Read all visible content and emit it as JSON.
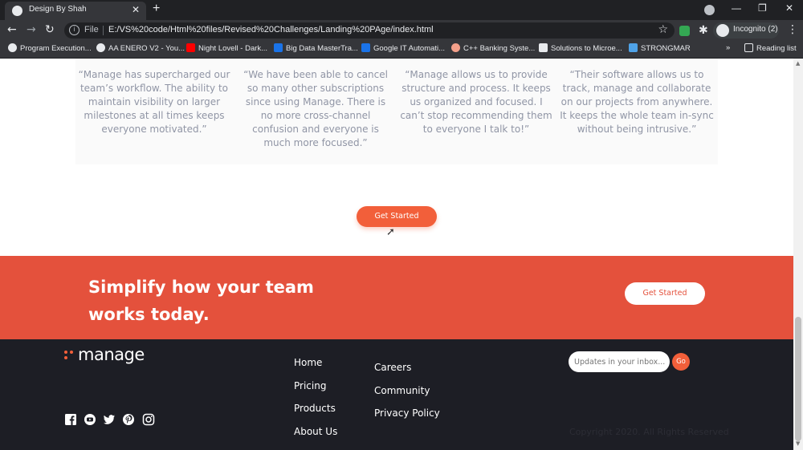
{
  "browser": {
    "tab_title": "Design By Shah",
    "file_label": "File",
    "url": "E:/VS%20code/Html%20files/Revised%20Challenges/Landing%20PAge/index.html",
    "incognito_label": "Incognito (2)",
    "bookmarks": [
      "Program Execution...",
      "AA ENERO V2 - You...",
      "Night Lovell - Dark...",
      "Big Data MasterTra...",
      "Google IT Automati...",
      "C++ Banking Syste...",
      "Solutions to Microe...",
      "STRONGMAR"
    ],
    "reading_list": "Reading list"
  },
  "testimonials": [
    "“Manage has supercharged our team’s workflow. The ability to maintain visibility on larger milestones at all times keeps everyone motivated.”",
    "“We have been able to cancel so many other subscriptions since using Manage. There is no more cross-channel confusion and everyone is much more focused.”",
    "“Manage allows us to provide structure and process. It keeps us organized and focused. I can’t stop recommending them to everyone I talk to!”",
    "“Their software allows us to track, manage and collaborate on our projects from anywhere. It keeps the whole team in-sync without being intrusive.”"
  ],
  "main_cta_label": "Get Started",
  "cta_banner": {
    "title": "Simplify how your team works today.",
    "button_label": "Get Started"
  },
  "footer": {
    "logo_text": "manage",
    "links_col1": [
      "Home",
      "Pricing",
      "Products",
      "About Us"
    ],
    "links_col2": [
      "Careers",
      "Community",
      "Privacy Policy"
    ],
    "newsletter_placeholder": "Updates in your inbox...",
    "go_label": "Go",
    "copyright": "Copyright 2020. All Rights Reserved",
    "social_icons": [
      "facebook-icon",
      "youtube-icon",
      "twitter-icon",
      "pinterest-icon",
      "instagram-icon"
    ]
  },
  "colors": {
    "accent": "#f25f3a",
    "banner": "#e4513c",
    "footer_bg": "#1d1e25",
    "quote_text": "#9095a5"
  }
}
